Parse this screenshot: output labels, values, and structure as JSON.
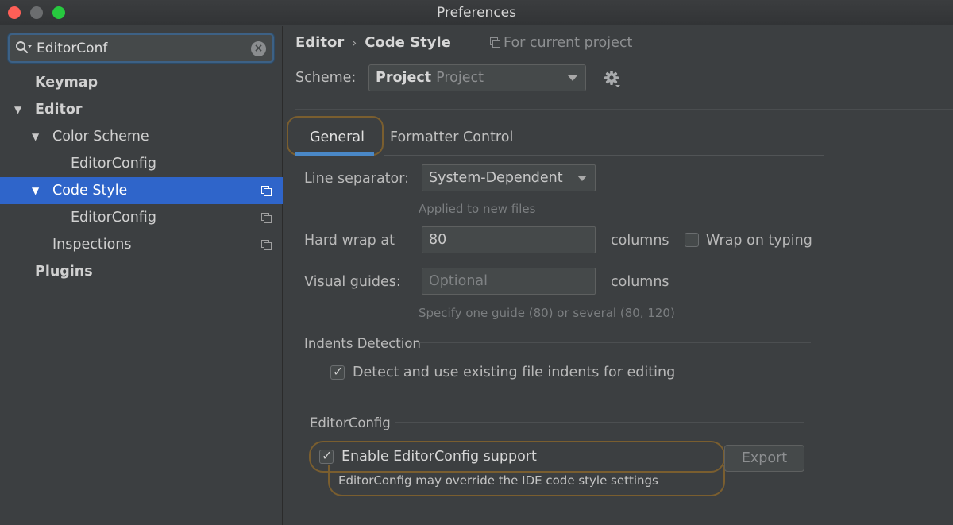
{
  "window": {
    "title": "Preferences"
  },
  "sidebar": {
    "search": {
      "value": "EditorConf",
      "placeholder": ""
    },
    "items": [
      {
        "label": "Keymap"
      },
      {
        "label": "Editor"
      },
      {
        "label": "Color Scheme"
      },
      {
        "label": "EditorConfig"
      },
      {
        "label": "Code Style"
      },
      {
        "label": "EditorConfig"
      },
      {
        "label": "Inspections"
      },
      {
        "label": "Plugins"
      }
    ]
  },
  "header": {
    "breadcrumb_parent": "Editor",
    "breadcrumb_current": "Code Style",
    "for_project": "For current project"
  },
  "scheme": {
    "label": "Scheme:",
    "value_bold": "Project",
    "value_secondary": "Project"
  },
  "tabs": [
    {
      "label": "General",
      "selected": true
    },
    {
      "label": "Formatter Control",
      "selected": false
    }
  ],
  "general": {
    "line_separator": {
      "label": "Line separator:",
      "value": "System-Dependent",
      "hint": "Applied to new files"
    },
    "hard_wrap": {
      "label": "Hard wrap at",
      "value": "80",
      "unit": "columns",
      "wrap_on_typing_label": "Wrap on typing",
      "wrap_on_typing_checked": false
    },
    "visual_guides": {
      "label": "Visual guides:",
      "placeholder": "Optional",
      "unit": "columns",
      "hint": "Specify one guide (80) or several (80, 120)"
    },
    "indents": {
      "title": "Indents Detection",
      "detect_label": "Detect and use existing file indents for editing",
      "detect_checked": true
    },
    "editorconfig": {
      "title": "EditorConfig",
      "enable_label": "Enable EditorConfig support",
      "enable_checked": true,
      "note": "EditorConfig may override the IDE code style settings",
      "export_label": "Export"
    }
  },
  "colors": {
    "selection": "#2f65ca",
    "highlight_ring": "#7a5e2f",
    "tab_underline": "#4a88c7"
  }
}
